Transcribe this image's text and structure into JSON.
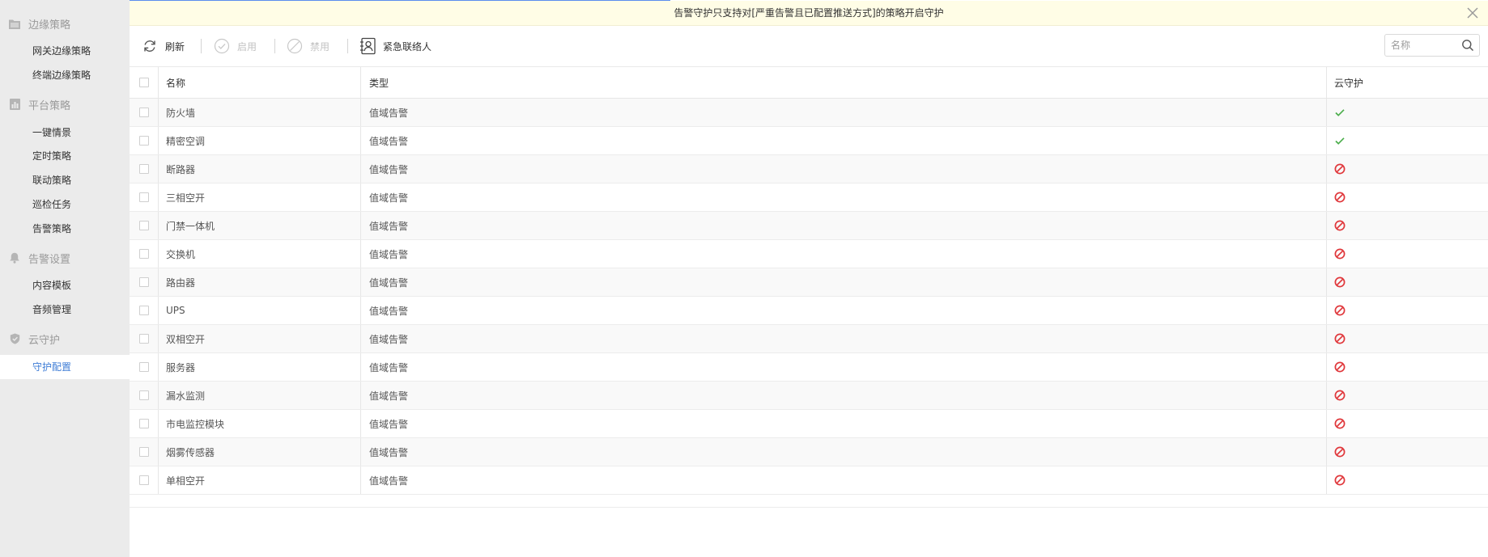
{
  "sidebar": {
    "groups": [
      {
        "label": "边缘策略",
        "icon": "folder-icon",
        "items": [
          {
            "label": "网关边缘策略"
          },
          {
            "label": "终端边缘策略"
          }
        ]
      },
      {
        "label": "平台策略",
        "icon": "report-icon",
        "items": [
          {
            "label": "一键情景"
          },
          {
            "label": "定时策略"
          },
          {
            "label": "联动策略"
          },
          {
            "label": "巡检任务"
          },
          {
            "label": "告警策略"
          }
        ]
      },
      {
        "label": "告警设置",
        "icon": "bell-icon",
        "items": [
          {
            "label": "内容模板"
          },
          {
            "label": "音频管理"
          }
        ]
      },
      {
        "label": "云守护",
        "icon": "shield-icon",
        "items": [
          {
            "label": "守护配置",
            "active": true
          }
        ]
      }
    ]
  },
  "banner": {
    "text": "告警守护只支持对[严重告警且已配置推送方式]的策略开启守护",
    "close_icon": "close-icon"
  },
  "toolbar": {
    "refresh_label": "刷新",
    "enable_label": "启用",
    "disable_label": "禁用",
    "contact_label": "紧急联络人",
    "search_placeholder": "名称"
  },
  "table": {
    "columns": [
      "名称",
      "类型",
      "云守护"
    ],
    "rows": [
      {
        "name": "防火墙",
        "type": "值域告警",
        "cloud_guard": true
      },
      {
        "name": "精密空调",
        "type": "值域告警",
        "cloud_guard": true
      },
      {
        "name": "断路器",
        "type": "值域告警",
        "cloud_guard": false
      },
      {
        "name": "三相空开",
        "type": "值域告警",
        "cloud_guard": false
      },
      {
        "name": "门禁一体机",
        "type": "值域告警",
        "cloud_guard": false
      },
      {
        "name": "交换机",
        "type": "值域告警",
        "cloud_guard": false
      },
      {
        "name": "路由器",
        "type": "值域告警",
        "cloud_guard": false
      },
      {
        "name": "UPS",
        "type": "值域告警",
        "cloud_guard": false
      },
      {
        "name": "双相空开",
        "type": "值域告警",
        "cloud_guard": false
      },
      {
        "name": "服务器",
        "type": "值域告警",
        "cloud_guard": false
      },
      {
        "name": "漏水监测",
        "type": "值域告警",
        "cloud_guard": false
      },
      {
        "name": "市电监控模块",
        "type": "值域告警",
        "cloud_guard": false
      },
      {
        "name": "烟雾传感器",
        "type": "值域告警",
        "cloud_guard": false
      },
      {
        "name": "单相空开",
        "type": "值域告警",
        "cloud_guard": false
      }
    ]
  },
  "colors": {
    "accent": "#3f7dd6",
    "enabled": "#4cae4c",
    "disabled": "#e0373b",
    "banner_bg": "#fffde6",
    "sidebar_bg": "#ebebeb"
  }
}
